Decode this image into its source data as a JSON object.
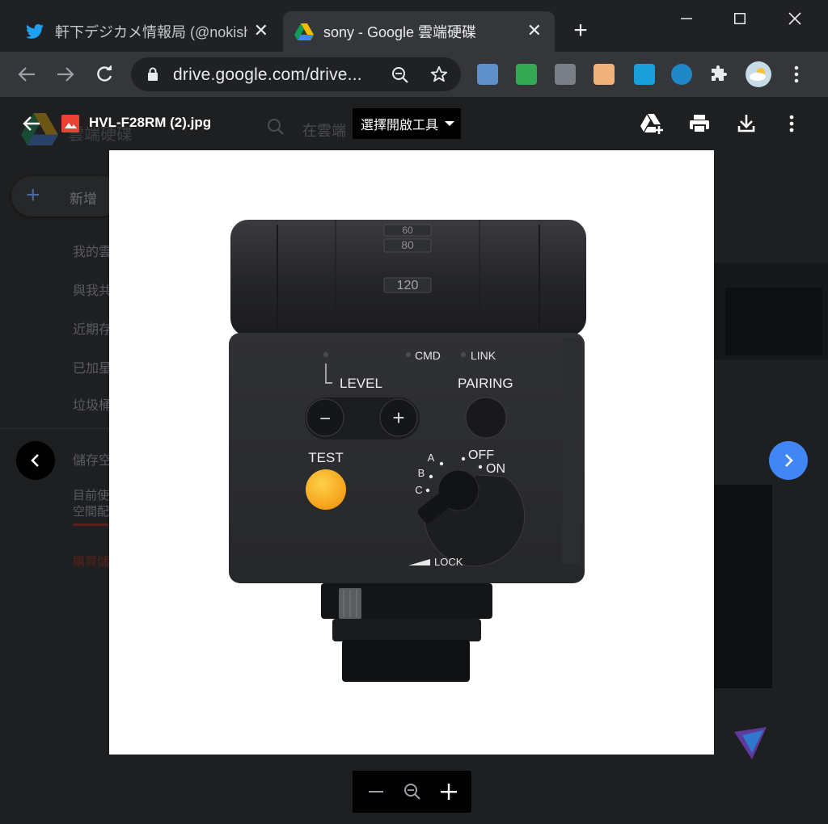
{
  "tabs": [
    {
      "title": "軒下デジカメ情報局 (@nokishita_camera)",
      "icon": "twitter-icon",
      "active": false
    },
    {
      "title": "sony - Google 雲端硬碟",
      "icon": "google-drive-icon",
      "active": true
    }
  ],
  "omnibox": {
    "url": "drive.google.com/drive..."
  },
  "drive_bg": {
    "new_label": "新增",
    "search_placeholder": "在雲端",
    "nav": [
      "我的雲",
      "與我共",
      "近期存",
      "已加星",
      "垃圾桶",
      "儲存空",
      "目前使",
      "空間配",
      "購買儲"
    ],
    "brand": "雲端硬碟"
  },
  "viewer": {
    "file_name": "HVL-F28RM (2).jpg",
    "open_with": "選擇開啟工具",
    "image_labels": {
      "zoom_top": "60",
      "zoom_mid": "80",
      "zoom_bottom": "120",
      "cmd": "CMD",
      "link": "LINK",
      "level": "LEVEL",
      "pairing": "PAIRING",
      "test": "TEST",
      "off": "OFF",
      "on": "ON",
      "a": "A",
      "b": "B",
      "c": "C",
      "lock": "LOCK",
      "minus": "−",
      "plus": "+"
    }
  },
  "colors": {
    "accent": "#4285f4",
    "test_button": "#f9a825",
    "title_bar": "#202124",
    "toolbar": "#35363a"
  }
}
